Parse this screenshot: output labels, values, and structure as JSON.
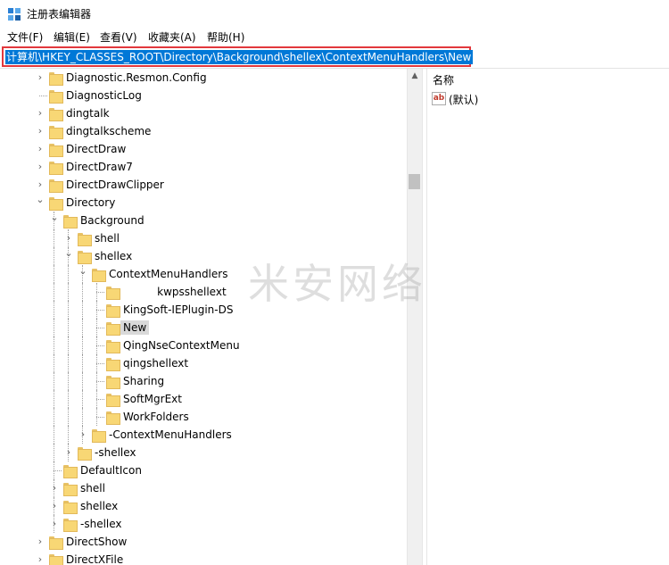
{
  "window": {
    "title": "注册表编辑器",
    "icon": "regedit-icon"
  },
  "menu": [
    {
      "label": "文件(F)"
    },
    {
      "label": "编辑(E)"
    },
    {
      "label": "查看(V)"
    },
    {
      "label": "收藏夹(A)"
    },
    {
      "label": "帮助(H)"
    }
  ],
  "address": {
    "path": "计算机\\HKEY_CLASSES_ROOT\\Directory\\Background\\shellex\\ContextMenuHandlers\\New"
  },
  "tree": [
    {
      "label": "Diagnostic.Resmon.Config",
      "level": 0,
      "exp": "closed"
    },
    {
      "label": "DiagnosticLog",
      "level": 0,
      "exp": "none"
    },
    {
      "label": "dingtalk",
      "level": 0,
      "exp": "closed"
    },
    {
      "label": "dingtalkscheme",
      "level": 0,
      "exp": "closed"
    },
    {
      "label": "DirectDraw",
      "level": 0,
      "exp": "closed"
    },
    {
      "label": "DirectDraw7",
      "level": 0,
      "exp": "closed"
    },
    {
      "label": "DirectDrawClipper",
      "level": 0,
      "exp": "closed"
    },
    {
      "label": "Directory",
      "level": 0,
      "exp": "open"
    },
    {
      "label": "Background",
      "level": 1,
      "exp": "open"
    },
    {
      "label": "shell",
      "level": 2,
      "exp": "closed"
    },
    {
      "label": "shellex",
      "level": 2,
      "exp": "open"
    },
    {
      "label": "ContextMenuHandlers",
      "level": 3,
      "exp": "open"
    },
    {
      "label": "          kwpsshellext",
      "level": 4,
      "exp": "none"
    },
    {
      "label": "KingSoft-IEPlugin-DS",
      "level": 4,
      "exp": "none"
    },
    {
      "label": "New",
      "level": 4,
      "exp": "none",
      "selected": true
    },
    {
      "label": "QingNseContextMenu",
      "level": 4,
      "exp": "none"
    },
    {
      "label": "qingshellext",
      "level": 4,
      "exp": "none"
    },
    {
      "label": "Sharing",
      "level": 4,
      "exp": "none"
    },
    {
      "label": "SoftMgrExt",
      "level": 4,
      "exp": "none"
    },
    {
      "label": "WorkFolders",
      "level": 4,
      "exp": "none"
    },
    {
      "label": "-ContextMenuHandlers",
      "level": 3,
      "exp": "closed"
    },
    {
      "label": "-shellex",
      "level": 2,
      "exp": "closed"
    },
    {
      "label": "DefaultIcon",
      "level": 1,
      "exp": "none"
    },
    {
      "label": "shell",
      "level": 1,
      "exp": "closed"
    },
    {
      "label": "shellex",
      "level": 1,
      "exp": "closed"
    },
    {
      "label": "-shellex",
      "level": 1,
      "exp": "closed"
    },
    {
      "label": "DirectShow",
      "level": 0,
      "exp": "closed"
    },
    {
      "label": "DirectXFile",
      "level": 0,
      "exp": "closed"
    }
  ],
  "values_pane": {
    "column_name": "名称",
    "rows": [
      {
        "icon": "string-value-icon",
        "type_glyph": "ab",
        "name": "(默认)"
      }
    ]
  },
  "watermark": "米安网络",
  "colors": {
    "selection": "#0078d7",
    "highlight_border": "#e2383c",
    "folder": "#f8d775"
  }
}
